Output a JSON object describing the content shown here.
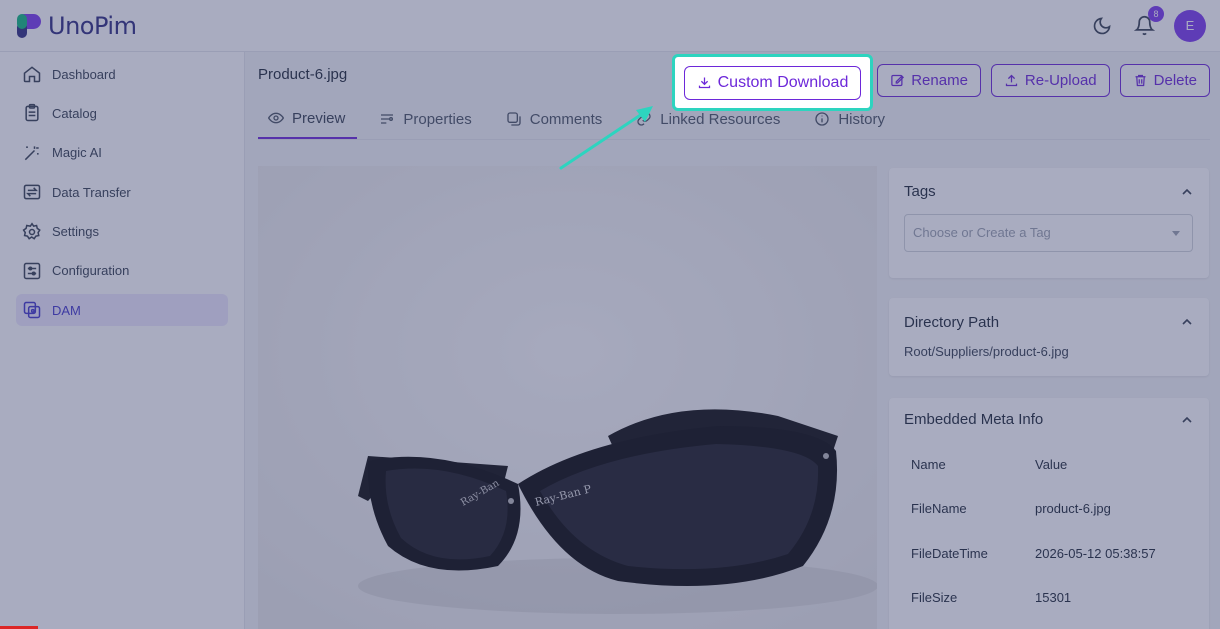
{
  "header": {
    "logo_text": "UnoPim",
    "notification_count": "8",
    "avatar_initial": "E"
  },
  "sidebar": {
    "items": [
      {
        "label": "Dashboard",
        "icon": "home-icon"
      },
      {
        "label": "Catalog",
        "icon": "clipboard-icon"
      },
      {
        "label": "Magic AI",
        "icon": "magic-wand-icon"
      },
      {
        "label": "Data Transfer",
        "icon": "transfer-icon"
      },
      {
        "label": "Settings",
        "icon": "gear-icon"
      },
      {
        "label": "Configuration",
        "icon": "sliders-icon"
      },
      {
        "label": "DAM",
        "icon": "images-icon",
        "active": true
      }
    ]
  },
  "asset": {
    "title": "Product-6.jpg"
  },
  "actions": {
    "custom_download": "Custom Download",
    "rename": "Rename",
    "reupload": "Re-Upload",
    "delete": "Delete"
  },
  "tabs": [
    {
      "label": "Preview",
      "active": true
    },
    {
      "label": "Properties"
    },
    {
      "label": "Comments"
    },
    {
      "label": "Linked Resources"
    },
    {
      "label": "History"
    }
  ],
  "tags_panel": {
    "title": "Tags",
    "placeholder": "Choose or Create a Tag"
  },
  "directory_panel": {
    "title": "Directory Path",
    "path": "Root/Suppliers/product-6.jpg"
  },
  "meta_panel": {
    "title": "Embedded Meta Info",
    "headers": [
      "Name",
      "Value"
    ],
    "rows": [
      {
        "name": "FileName",
        "value": "product-6.jpg"
      },
      {
        "name": "FileDateTime",
        "value": "2026-05-12 05:38:57"
      },
      {
        "name": "FileSize",
        "value": "15301"
      }
    ]
  },
  "colors": {
    "accent": "#6d28d9",
    "highlight": "#2dd4bf",
    "overlay": "#373e6e"
  }
}
